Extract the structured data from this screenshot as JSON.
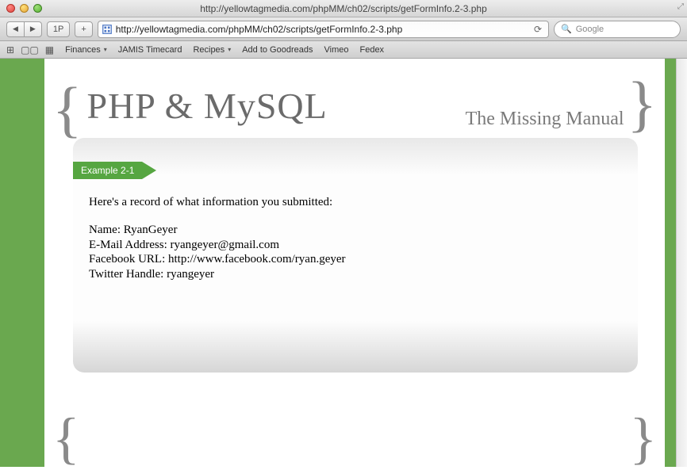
{
  "window": {
    "title": "http://yellowtagmedia.com/phpMM/ch02/scripts/getFormInfo.2-3.php"
  },
  "toolbar": {
    "onep_label": "1P",
    "plus_label": "+",
    "url": "http://yellowtagmedia.com/phpMM/ch02/scripts/getFormInfo.2-3.php",
    "search_placeholder": "Google"
  },
  "bookmarks": {
    "items": [
      {
        "label": "Finances",
        "menu": true
      },
      {
        "label": "JAMIS Timecard",
        "menu": false
      },
      {
        "label": "Recipes",
        "menu": true
      },
      {
        "label": "Add to Goodreads",
        "menu": false
      },
      {
        "label": "Vimeo",
        "menu": false
      },
      {
        "label": "Fedex",
        "menu": false
      }
    ]
  },
  "page": {
    "title": "PHP & MySQL",
    "subtitle": "The Missing Manual",
    "example_label": "Example 2-1",
    "intro": "Here's a record of what information you submitted:",
    "records": [
      {
        "label": "Name",
        "value": "RyanGeyer"
      },
      {
        "label": "E-Mail Address",
        "value": "ryangeyer@gmail.com"
      },
      {
        "label": "Facebook URL",
        "value": "http://www.facebook.com/ryan.geyer"
      },
      {
        "label": "Twitter Handle",
        "value": "ryangeyer"
      }
    ]
  }
}
